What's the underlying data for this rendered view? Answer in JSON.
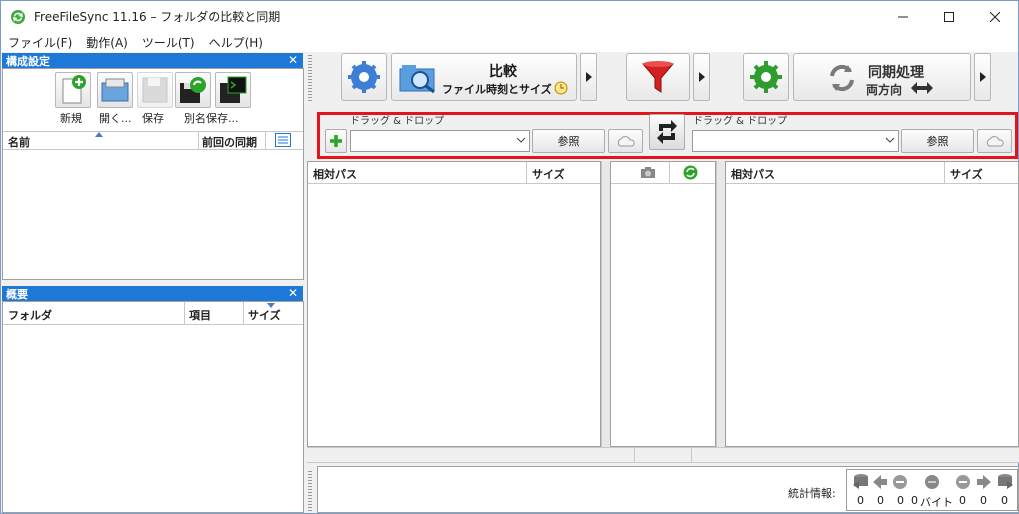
{
  "window": {
    "title": "FreeFileSync 11.16 – フォルダの比較と同期"
  },
  "menu": [
    "ファイル(F)",
    "動作(A)",
    "ツール(T)",
    "ヘルプ(H)"
  ],
  "config_panel": {
    "title": "構成設定",
    "buttons": {
      "new": "新規",
      "open": "開く...",
      "save": "保存",
      "save_as": "別名保存..."
    },
    "columns": {
      "name": "名前",
      "last_sync": "前回の同期"
    }
  },
  "overview_panel": {
    "title": "概要",
    "columns": {
      "folder": "フォルダ",
      "items": "項目",
      "size": "サイズ"
    }
  },
  "main_toolbar": {
    "compare_title": "比較",
    "compare_sub": "ファイル時刻とサイズ",
    "sync_title": "同期処理",
    "sync_sub": "両方向"
  },
  "folder_pair": {
    "left_label": "ドラッグ & ドロップ",
    "right_label": "ドラッグ & ドロップ",
    "left_value": "",
    "right_value": "",
    "browse_left": "参照",
    "browse_right": "参照"
  },
  "grid": {
    "left_cols": {
      "path": "相対パス",
      "size": "サイズ"
    },
    "right_cols": {
      "path": "相対パス",
      "size": "サイズ"
    }
  },
  "statistics": {
    "label": "統計情報:",
    "values": [
      "0",
      "0",
      "0",
      "0",
      "0",
      "0",
      "0"
    ],
    "bytes_label": "バイト"
  },
  "colors": {
    "accent": "#1e78d8",
    "highlight": "#e0161c",
    "green": "#2aa52a",
    "red": "#d42020"
  }
}
